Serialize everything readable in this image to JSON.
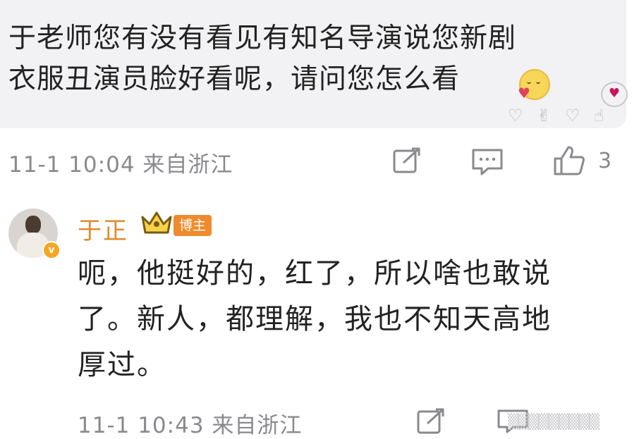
{
  "comment": {
    "lines": [
      "于老师您有没有看见有知名导演说您新剧",
      "衣服丑演员脸好看呢，请问您怎么看"
    ],
    "time": "11-1 10:04",
    "location": "来自浙江",
    "like_count": "3"
  },
  "reply": {
    "username": "于正",
    "badge": "博主",
    "verified_mark": "v",
    "lines": [
      "呃，他挺好的，红了，所以啥也敢说",
      "了。新人，都理解，我也不知天高地",
      "厚过。"
    ],
    "time": "11-1 10:43",
    "location": "来自浙江"
  },
  "icons": {
    "share": "share-icon",
    "comment": "comment-icon",
    "like": "thumbs-up-icon",
    "emoji": "blush-emoji-icon",
    "crown": "crown-icon"
  },
  "colors": {
    "bubble_bg": "#f2f2f4",
    "username": "#e28a2b",
    "badge_bg": "#ef8b2c",
    "meta_text": "#8a8a8e"
  }
}
